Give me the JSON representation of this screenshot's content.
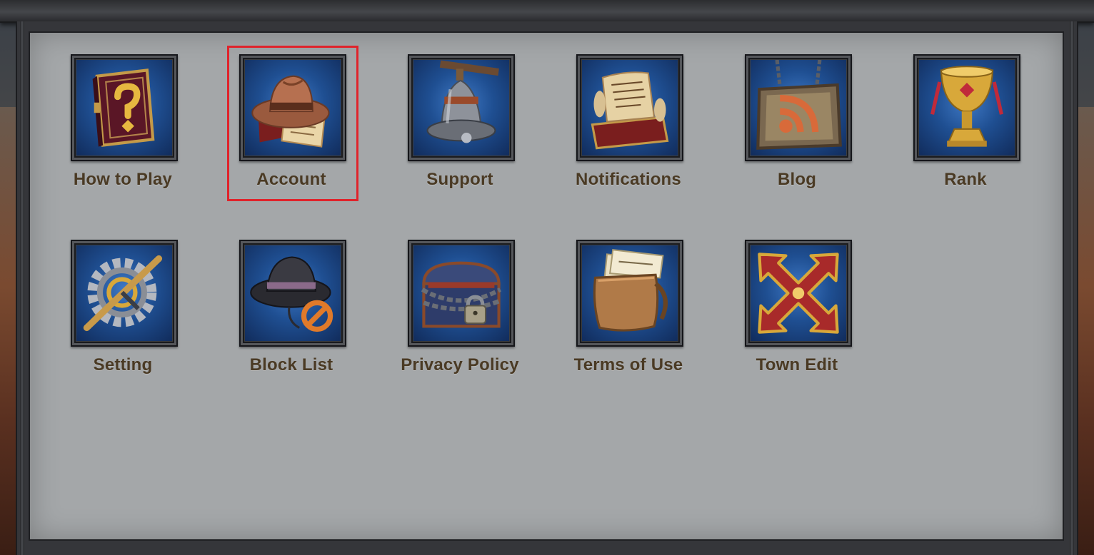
{
  "menu": {
    "items": [
      {
        "label": "How to Play",
        "icon": "spellbook-icon"
      },
      {
        "label": "Account",
        "icon": "cowboy-hat-scroll-icon"
      },
      {
        "label": "Support",
        "icon": "bell-icon"
      },
      {
        "label": "Notifications",
        "icon": "scroll-chest-icon"
      },
      {
        "label": "Blog",
        "icon": "rss-sign-icon"
      },
      {
        "label": "Rank",
        "icon": "trophy-icon"
      },
      {
        "label": "Setting",
        "icon": "gear-icon"
      },
      {
        "label": "Block List",
        "icon": "blocked-hat-icon"
      },
      {
        "label": "Privacy Policy",
        "icon": "locked-chest-icon"
      },
      {
        "label": "Terms of Use",
        "icon": "document-satchel-icon"
      },
      {
        "label": "Town Edit",
        "icon": "move-arrows-icon"
      }
    ]
  },
  "highlighted_item": "Account",
  "colors": {
    "panel": "#a4a7a9",
    "label": "#4a3a24",
    "icon_background": "#1f4f92",
    "highlight": "#e0232b",
    "frame": "#35363a"
  }
}
